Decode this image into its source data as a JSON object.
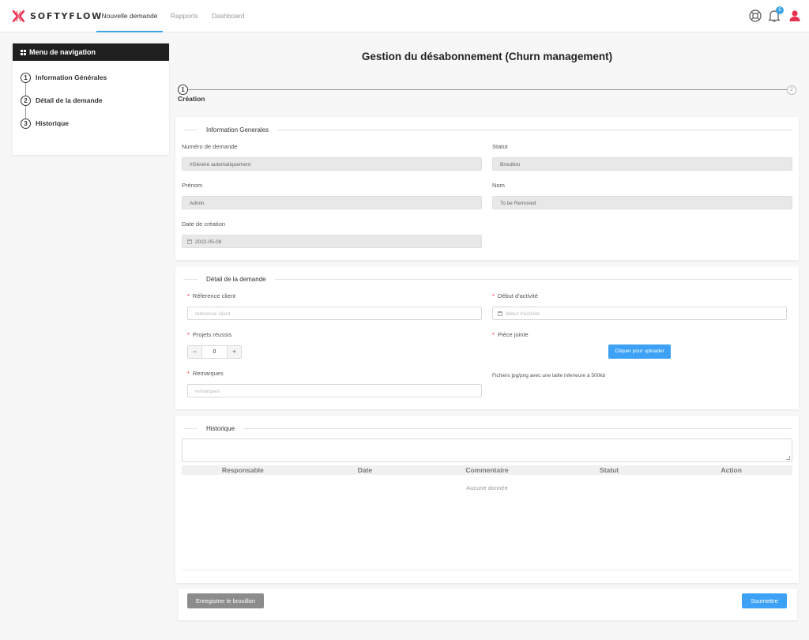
{
  "app": {
    "brand": "SOFTYFLOW",
    "brand_color": "#e8304f",
    "accent": "#3da2f5"
  },
  "topnav": {
    "tabs": [
      {
        "label": "Nouvelle demande",
        "active": true
      },
      {
        "label": "Rapports",
        "active": false
      },
      {
        "label": "Dashboard",
        "active": false
      }
    ],
    "notifications_count": "5",
    "icons": [
      "support-icon",
      "bell-icon",
      "user-icon"
    ]
  },
  "sidebar": {
    "title": "Menu de navigation",
    "items": [
      {
        "num": "1",
        "label": "Information Générales"
      },
      {
        "num": "2",
        "label": "Détail de la demande"
      },
      {
        "num": "3",
        "label": "Historique"
      }
    ]
  },
  "page": {
    "title": "Gestion du désabonnement (Churn management)",
    "stepper": {
      "step1": "1",
      "step2": "2",
      "label": "Création"
    }
  },
  "general": {
    "legend": "Information Generales",
    "numero_label": "Numéro de demande",
    "numero_value": "#Généré automatiquement",
    "statut_label": "Statut",
    "statut_value": "Brouillon",
    "prenom_label": "Prénom",
    "prenom_value": "Admin",
    "nom_label": "Nom",
    "nom_value": "To be Removed",
    "date_label": "Date de création",
    "date_value": "2022-05-09"
  },
  "detail": {
    "legend": "Détail de la demande",
    "reference_label": "Réference client",
    "reference_placeholder": "réference client",
    "debut_label": "Début d'activité",
    "debut_placeholder": "début d'activité",
    "projets_label": "Projets réussis",
    "projets_value": "0",
    "piece_label": "Pièce jointe",
    "upload_button": "Cliquer pour uploader",
    "upload_hint": "Fichiers jpg/png avec une taille inferieure à 500kb",
    "remarques_label": "Remarques",
    "remarques_placeholder": "remarques"
  },
  "historique": {
    "legend": "Historique",
    "columns": [
      "Responsable",
      "Date",
      "Commentaire",
      "Statut",
      "Action"
    ],
    "empty_text": "Aucune donnée"
  },
  "footer": {
    "draft_button": "Enregistrer le brouillon",
    "submit_button": "Soumettre"
  }
}
